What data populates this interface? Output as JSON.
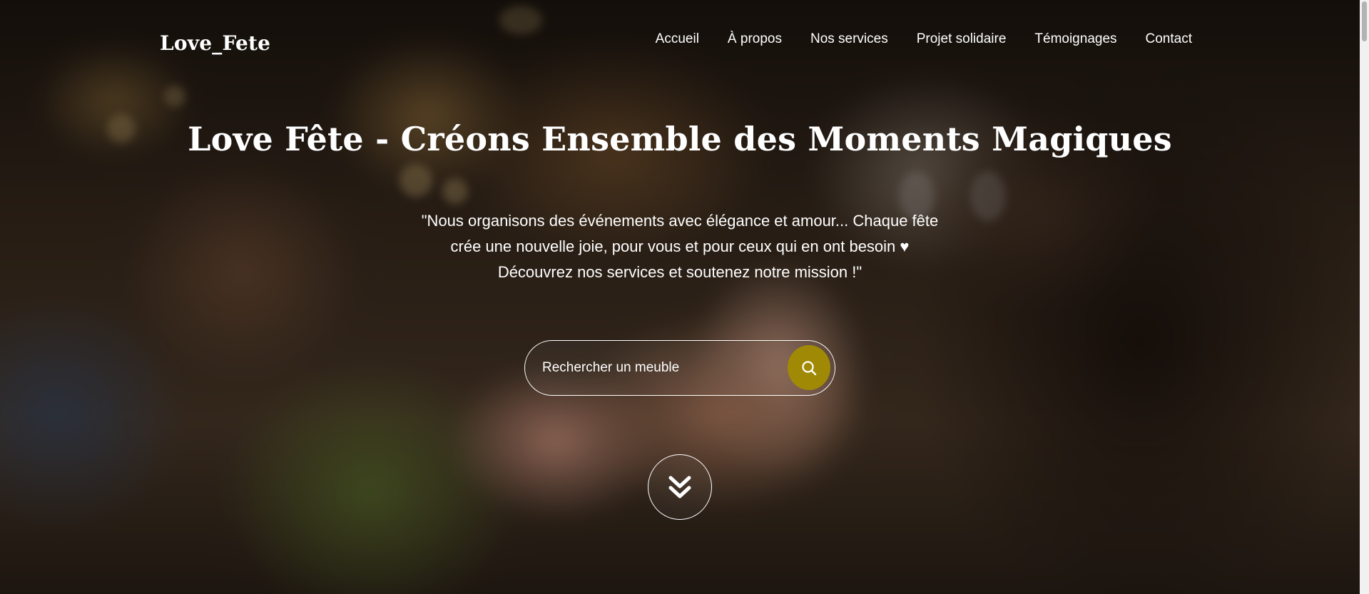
{
  "brand": {
    "name": "Love_Fete"
  },
  "nav": {
    "items": [
      {
        "label": "Accueil"
      },
      {
        "label": "À propos"
      },
      {
        "label": "Nos services"
      },
      {
        "label": "Projet solidaire"
      },
      {
        "label": "Témoignages"
      },
      {
        "label": "Contact"
      }
    ]
  },
  "hero": {
    "title": "Love Fête - Créons Ensemble des Moments Magiques",
    "tagline": "\"Nous organisons des événements avec élégance et amour... Chaque fête crée une nouvelle joie, pour vous et pour ceux qui en ont besoin ♥ Découvrez nos services et soutenez notre mission !\""
  },
  "search": {
    "placeholder": "Rechercher un meuble",
    "icon": "search-icon",
    "button_color": "#a08a05"
  },
  "scroll_down": {
    "icon": "double-chevron-down-icon"
  }
}
